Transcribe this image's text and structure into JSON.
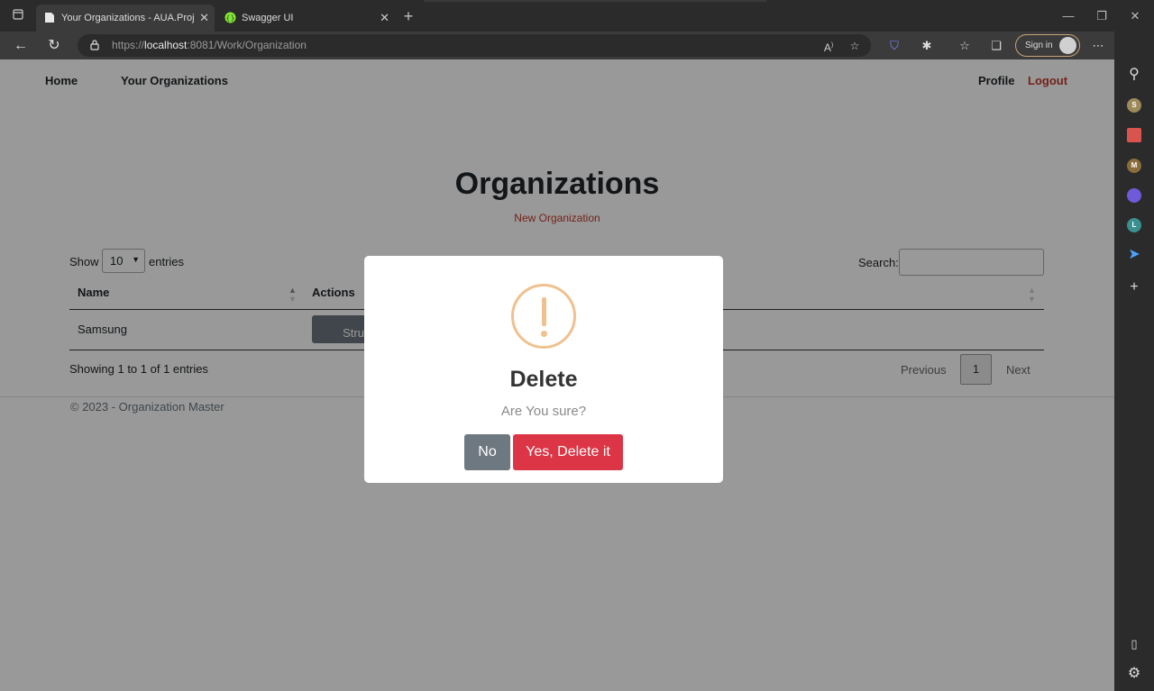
{
  "browser": {
    "tabs": [
      {
        "title": "Your Organizations - AUA.Project",
        "active": true
      },
      {
        "title": "Swagger UI",
        "active": false
      }
    ],
    "url_prefix": "https://",
    "url_host": "localhost",
    "url_rest": ":8081/Work/Organization",
    "sign_in_label": "Sign in"
  },
  "nav": {
    "home": "Home",
    "orgs": "Your Organizations",
    "profile": "Profile",
    "logout": "Logout"
  },
  "main": {
    "title": "Organizations",
    "new_link": "New Organization",
    "show_label": "Show",
    "entries_value": "10",
    "entries_label": "entries",
    "search_label": "Search:",
    "columns": [
      "Name",
      "Actions"
    ],
    "rows": [
      {
        "name": "Samsung",
        "action": "Structure"
      }
    ],
    "info": "Showing 1 to 1 of 1 entries",
    "pagination": {
      "previous": "Previous",
      "page": "1",
      "next": "Next"
    }
  },
  "footer": "© 2023 - Organization Master",
  "modal": {
    "title": "Delete",
    "text": "Are You sure?",
    "no_label": "No",
    "yes_label": "Yes, Delete it"
  },
  "sidebar_icons": [
    "search-icon",
    "s-avatar-icon",
    "toolbox-icon",
    "m-avatar-icon",
    "copilot-icon",
    "l-avatar-icon",
    "send-icon",
    "add-icon",
    "split-view-icon",
    "settings-icon"
  ],
  "colors": {
    "danger": "#dc3545",
    "secondary": "#6c757d",
    "warning": "#f0c08f",
    "link": "#c0392b"
  }
}
